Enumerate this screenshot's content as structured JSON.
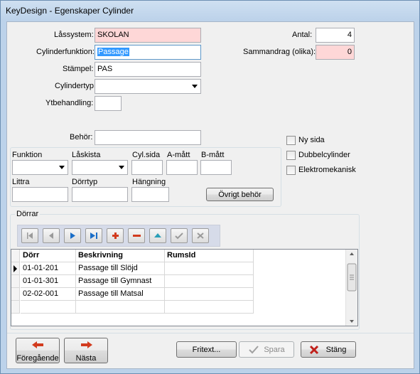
{
  "window": {
    "title": "KeyDesign - Egenskaper Cylinder"
  },
  "form": {
    "lassystem_label": "Låssystem:",
    "lassystem_value": "SKOLAN",
    "cylinderfunktion_label": "Cylinderfunktion:",
    "cylinderfunktion_value": "Passage",
    "stampel_label": "Stämpel:",
    "stampel_value": "PAS",
    "cylindertyp_label": "Cylindertyp:",
    "cylindertyp_value": "",
    "ytbehandling_label": "Ytbehandling:",
    "ytbehandling_value": "",
    "behor_label": "Behör:",
    "behor_value": "",
    "antal_label": "Antal:",
    "antal_value": "4",
    "sammandrag_label": "Sammandrag (olika):",
    "sammandrag_value": "0"
  },
  "checkboxes": {
    "ny_sida": "Ny sida",
    "dubbelcylinder": "Dubbelcylinder",
    "elektromekanisk": "Elektromekanisk"
  },
  "fittings": {
    "funktion_label": "Funktion",
    "laskista_label": "Låskista",
    "cylsida_label": "Cyl.sida",
    "amatt_label": "A-mått",
    "bmatt_label": "B-mått",
    "littra_label": "Littra",
    "dorrtyp_label": "Dörrtyp",
    "hangning_label": "Hängning",
    "ovrigt_button": "Övrigt behör"
  },
  "doors": {
    "group_label": "Dörrar",
    "columns": [
      "Dörr",
      "Beskrivning",
      "RumsId"
    ],
    "rows": [
      {
        "dorr": "01-01-201",
        "beskrivning": "Passage till Slöjd",
        "rumsid": ""
      },
      {
        "dorr": "01-01-301",
        "beskrivning": "Passage till Gymnast",
        "rumsid": ""
      },
      {
        "dorr": "02-02-001",
        "beskrivning": "Passage till Matsal",
        "rumsid": ""
      }
    ]
  },
  "footer": {
    "prev_label": "Föregående",
    "next_label": "Nästa",
    "fritext_label": "Fritext...",
    "spara_label": "Spara",
    "stang_label": "Stäng"
  },
  "colors": {
    "pink_field": "#fed7d7",
    "selection": "#3399ff",
    "nav_blue": "#1a6ec8",
    "nav_red": "#d23b1e",
    "close_red": "#c0201a"
  }
}
